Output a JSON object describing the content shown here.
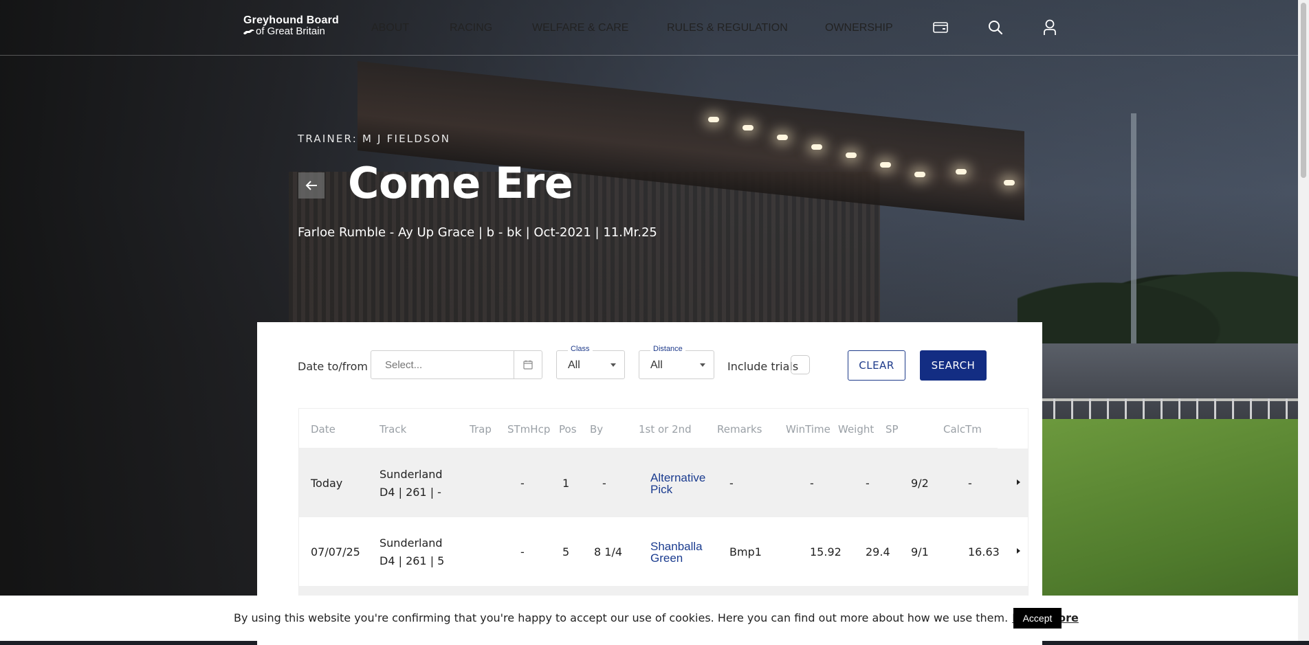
{
  "brand": {
    "line1": "Greyhound Board",
    "line2": "of Great Britain"
  },
  "nav": {
    "items": [
      "ABOUT",
      "RACING",
      "WELFARE & CARE",
      "RULES & REGULATION",
      "OWNERSHIP"
    ],
    "icons": [
      "wallet-icon",
      "search-icon",
      "user-icon"
    ]
  },
  "hero": {
    "trainer": "TRAINER: M J FIELDSON",
    "dog_name": "Come Ere",
    "pedigree": "Farloe Rumble - Ay Up Grace | b - bk | Oct-2021 | 11.Mr.25"
  },
  "filters": {
    "date_label": "Date to/from",
    "date_placeholder": "Select...",
    "class_legend": "Class",
    "class_value": "All",
    "distance_legend": "Distance",
    "distance_value": "All",
    "trials_label": "Include trials",
    "clear_label": "CLEAR",
    "search_label": "SEARCH"
  },
  "table": {
    "headers": [
      "Date",
      "Track",
      "Trap",
      "STmHcp",
      "Pos",
      "By",
      "1st or 2nd",
      "Remarks",
      "WinTime",
      "Weight",
      "SP",
      "CalcTm"
    ],
    "rows": [
      {
        "date": "Today",
        "track": "Sunderland",
        "track_detail": "D4 | 261 | -",
        "trap": "",
        "stmhcp": "-",
        "pos": "1",
        "by": "-",
        "first_second": "Alternative Pick",
        "remarks": "-",
        "wintime": "-",
        "weight": "-",
        "sp": "9/2",
        "calctm": "-"
      },
      {
        "date": "07/07/25",
        "track": "Sunderland",
        "track_detail": "D4 | 261 | 5",
        "trap": "",
        "stmhcp": "-",
        "pos": "5",
        "by": "8 1/4",
        "first_second": "Shanballa Green",
        "remarks": "Bmp1",
        "wintime": "15.92",
        "weight": "29.4",
        "sp": "9/1",
        "calctm": "16.63"
      }
    ]
  },
  "cookie": {
    "message": "By using this website you're confirming that you're happy to accept our use of cookies. Here you can find out more about how we use them.",
    "read_more": "Read More",
    "accept": "Accept"
  },
  "colors": {
    "primary_navy": "#132d83",
    "link_blue": "#1b3c8f",
    "row_alt": "#f0f0f0"
  }
}
